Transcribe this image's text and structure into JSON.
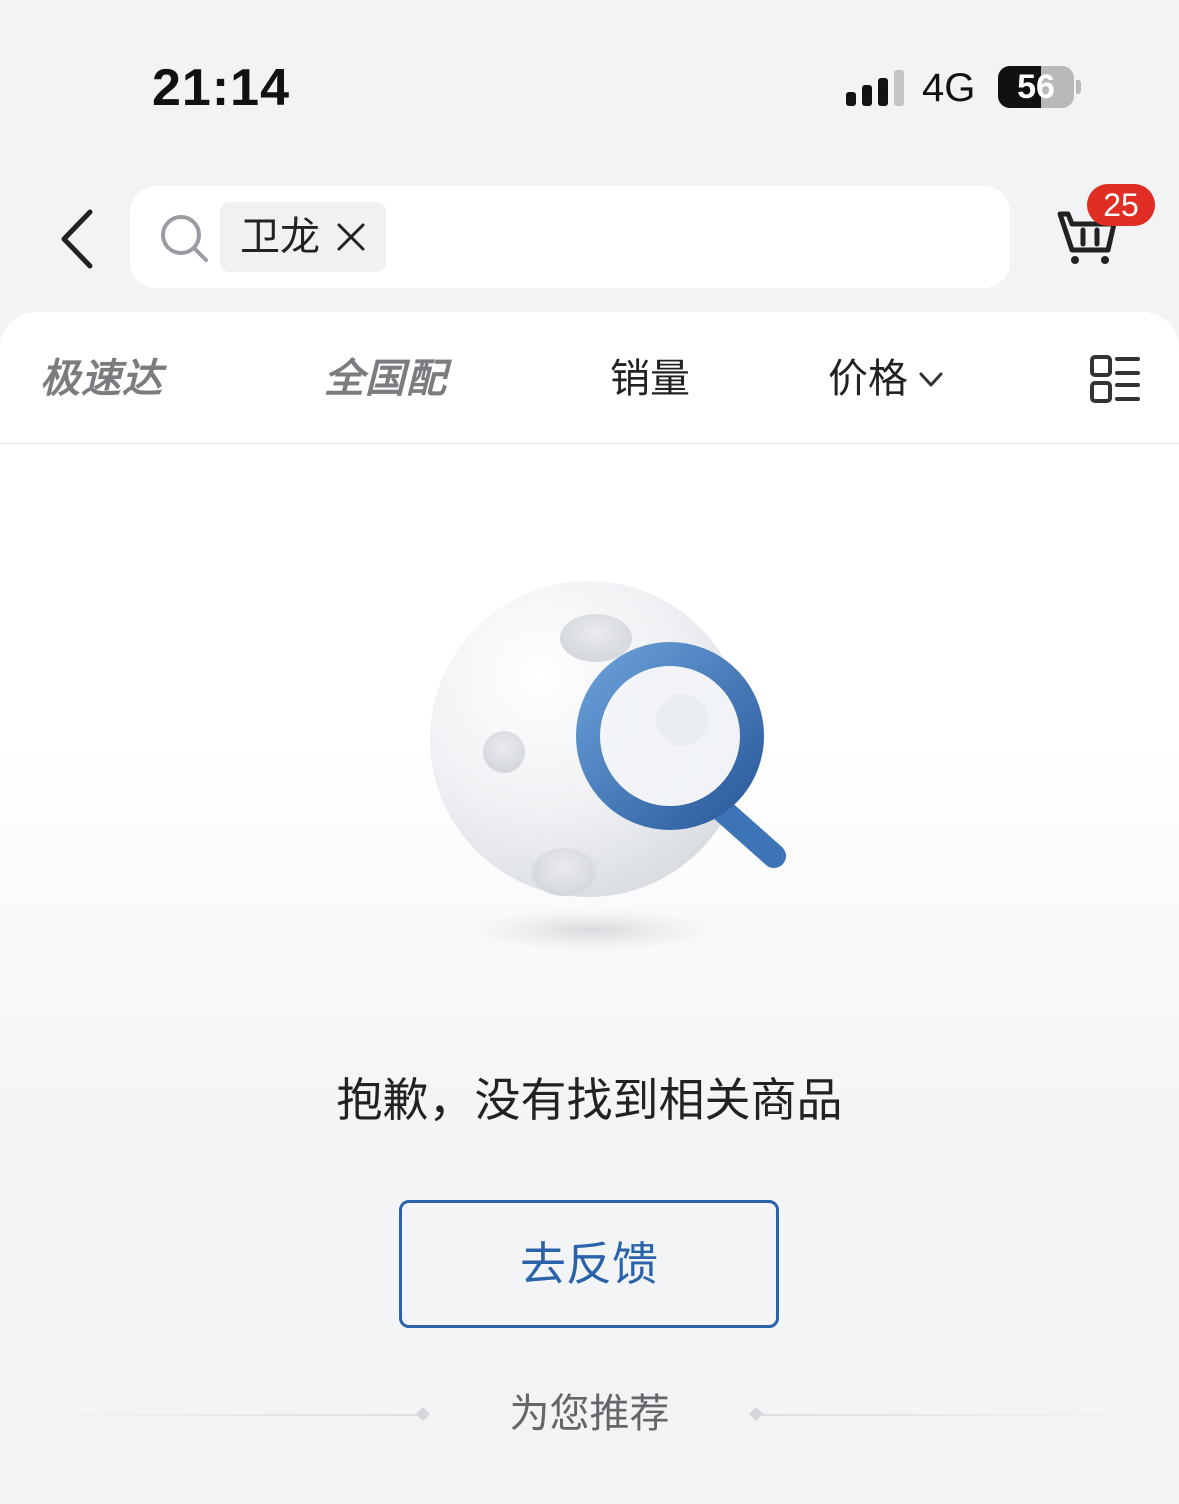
{
  "status_bar": {
    "time": "21:14",
    "network": "4G",
    "battery": "56",
    "battery_level": 0.56
  },
  "search": {
    "keyword": "卫龙"
  },
  "cart": {
    "badge_count": "25"
  },
  "filters": {
    "express_tag": "极速达",
    "nationwide_tag": "全国配",
    "sales_label": "销量",
    "price_label": "价格"
  },
  "empty_state": {
    "message": "抱歉，没有找到相关商品",
    "feedback_button": "去反馈"
  },
  "recommend": {
    "title": "为您推荐"
  },
  "colors": {
    "accent": "#2a63a9",
    "badge": "#e02e24",
    "background": "#f2f3f5"
  },
  "icons": [
    "back-icon",
    "search-icon",
    "close-icon",
    "cart-icon",
    "chevron-down-icon",
    "list-layout-icon",
    "empty-search-illustration"
  ]
}
